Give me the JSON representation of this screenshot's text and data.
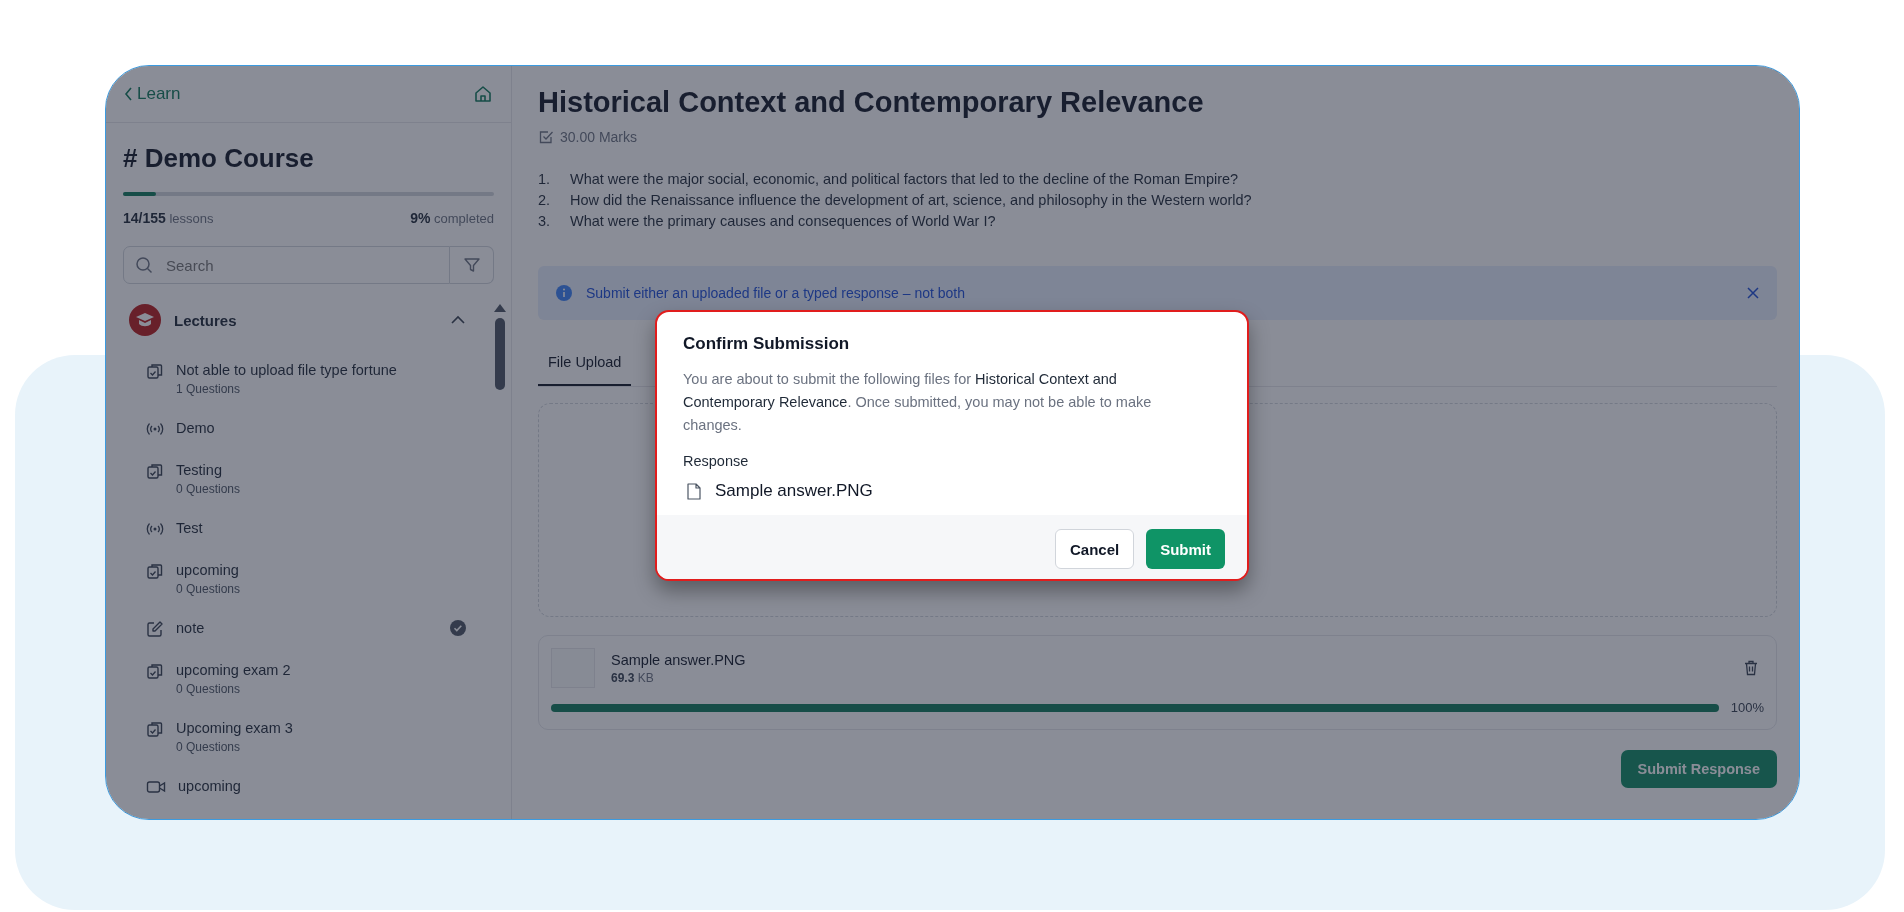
{
  "sidebar": {
    "back_link": "Learn",
    "course_title": "# Demo Course",
    "progress": {
      "level": 0.09,
      "lessons_count": "14/155",
      "lessons_label": "lessons",
      "percent": "9%",
      "percent_label": "completed"
    },
    "search": {
      "placeholder": "Search"
    },
    "section": {
      "title": "Lectures",
      "expanded": true,
      "items": [
        {
          "kind": "quiz",
          "title": "Not able to upload file type fortune",
          "subtitle": "1 Questions",
          "completed": false
        },
        {
          "kind": "live",
          "title": "Demo",
          "completed": false
        },
        {
          "kind": "quiz",
          "title": "Testing",
          "subtitle": "0 Questions",
          "completed": false
        },
        {
          "kind": "live",
          "title": "Test",
          "completed": false
        },
        {
          "kind": "quiz",
          "title": "upcoming",
          "subtitle": "0 Questions",
          "completed": false
        },
        {
          "kind": "note",
          "title": "note",
          "completed": true
        },
        {
          "kind": "quiz",
          "title": "upcoming exam 2",
          "subtitle": "0 Questions",
          "completed": false
        },
        {
          "kind": "quiz",
          "title": "Upcoming exam 3",
          "subtitle": "0 Questions",
          "completed": false
        },
        {
          "kind": "video",
          "title": "upcoming",
          "completed": false
        }
      ]
    }
  },
  "main": {
    "title": "Historical Context and Contemporary Relevance",
    "marks": "30.00 Marks",
    "questions": [
      {
        "number": "1.",
        "text": "What were the major social, economic, and political factors that led to the decline of the Roman Empire?"
      },
      {
        "number": "2.",
        "text": "How did the Renaissance influence the development of art, science, and philosophy in the Western world?"
      },
      {
        "number": "3.",
        "text": "What were the primary causes and consequences of World War I?"
      }
    ],
    "notice": "Submit either an uploaded file or a typed response – not both",
    "tabs": [
      {
        "label": "File Upload",
        "selected": true
      }
    ],
    "upload": {
      "file_name": "Sample answer.PNG",
      "size_value": "69.3",
      "size_unit": "KB",
      "level": 1,
      "percent": "100%"
    },
    "submit_button": "Submit Response"
  },
  "dialog": {
    "title": "Confirm Submission",
    "message": "You are about to submit the following files for **Historical Context and Contemporary Relevance**. Once submitted, you may not be able to make changes.",
    "section_label": "Response",
    "files": [
      "Sample answer.PNG"
    ],
    "buttons": [
      {
        "label": "Cancel",
        "kind": "secondary"
      },
      {
        "label": "Submit",
        "kind": "primary"
      }
    ]
  }
}
